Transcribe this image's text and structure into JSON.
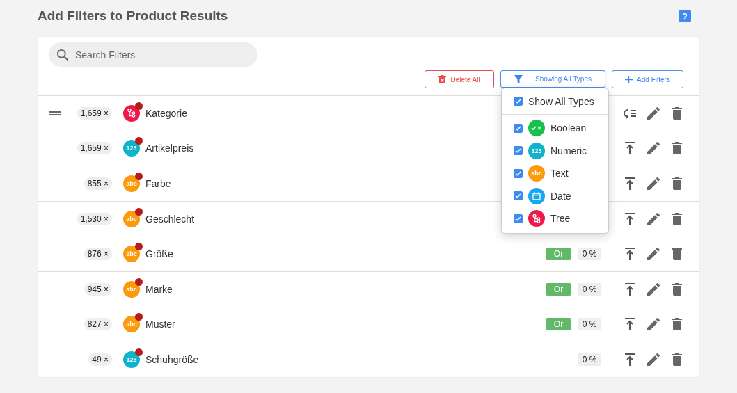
{
  "title": "Add Filters to Product Results",
  "help": "?",
  "search": {
    "placeholder": "Search Filters"
  },
  "actions": [
    {
      "kind": "delete",
      "label": "Delete All"
    },
    {
      "kind": "filter",
      "label": "Showing All Types",
      "expanded": true
    },
    {
      "kind": "add",
      "label": "Add Filters"
    }
  ],
  "type_menu": {
    "all": {
      "label": "Show All Types",
      "checked": true
    },
    "items": [
      {
        "kind": "boolean",
        "label": "Boolean",
        "checked": true
      },
      {
        "kind": "numeric",
        "label": "Numeric",
        "glyph": "123",
        "checked": true
      },
      {
        "kind": "text",
        "label": "Text",
        "glyph": "abc",
        "checked": true
      },
      {
        "kind": "date",
        "label": "Date",
        "checked": true
      },
      {
        "kind": "tree",
        "label": "Tree",
        "checked": true
      }
    ]
  },
  "rows": [
    {
      "count": "1,659 ×",
      "kind": "tree",
      "name": "Kategorie",
      "flagged": true,
      "draggable": true
    },
    {
      "count": "1,659 ×",
      "kind": "numeric",
      "glyph": "123",
      "name": "Artikelpreis",
      "flagged": true,
      "draggable": false
    },
    {
      "count": "855 ×",
      "kind": "text",
      "glyph": "abc",
      "name": "Farbe",
      "flagged": true,
      "draggable": false
    },
    {
      "count": "1,530 ×",
      "kind": "text",
      "glyph": "abc",
      "name": "Geschlecht",
      "flagged": true,
      "draggable": false
    },
    {
      "count": "876 ×",
      "kind": "text",
      "glyph": "abc",
      "name": "Größe",
      "flagged": true,
      "draggable": false,
      "mode": "Or",
      "share": "0 %"
    },
    {
      "count": "945 ×",
      "kind": "text",
      "glyph": "abc",
      "name": "Marke",
      "flagged": true,
      "draggable": false,
      "mode": "Or",
      "share": "0 %"
    },
    {
      "count": "827 ×",
      "kind": "text",
      "glyph": "abc",
      "name": "Muster",
      "flagged": true,
      "draggable": false,
      "mode": "Or",
      "share": "0 %"
    },
    {
      "count": "49 ×",
      "kind": "numeric",
      "glyph": "123",
      "name": "Schuhgröße",
      "flagged": true,
      "draggable": false,
      "share": "0 %"
    }
  ]
}
